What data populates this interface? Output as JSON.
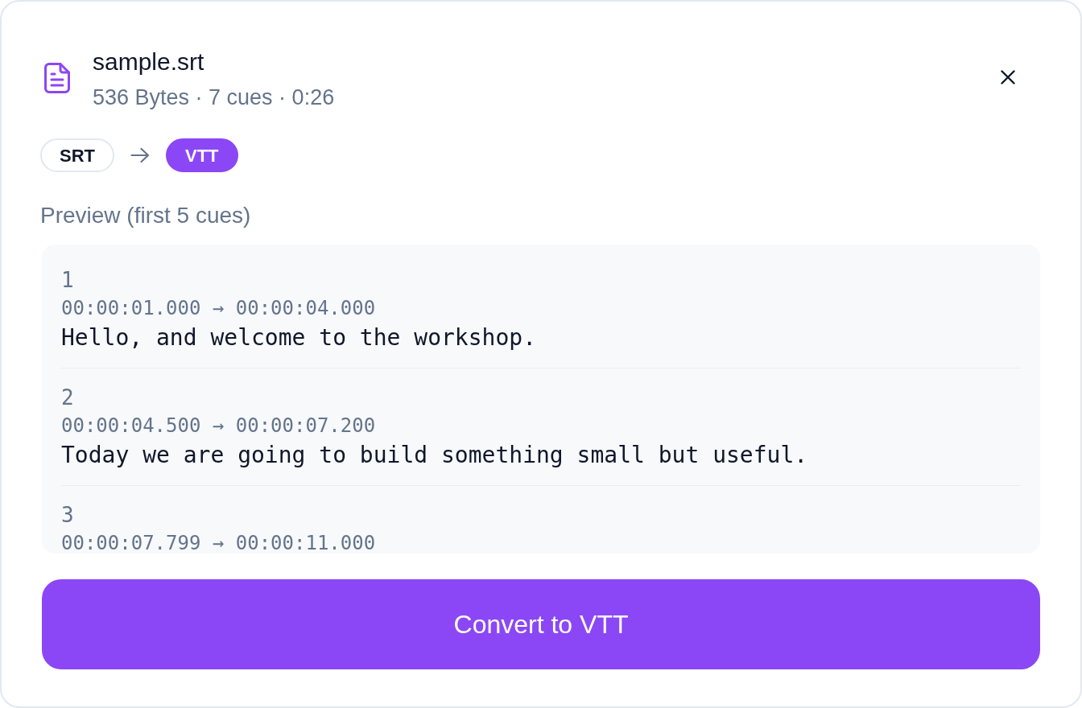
{
  "file": {
    "name": "sample.srt",
    "meta": "536 Bytes · 7 cues · 0:26"
  },
  "formats": [
    {
      "label": "SRT",
      "selected": false
    },
    {
      "label": "VTT",
      "selected": true
    }
  ],
  "preview": {
    "title": "Preview (first 5 cues)",
    "cues": [
      {
        "index": "1",
        "timing": "00:00:01.000 → 00:00:04.000",
        "text": "Hello, and welcome to the workshop."
      },
      {
        "index": "2",
        "timing": "00:00:04.500 → 00:00:07.200",
        "text": "Today we are going to build something small but useful."
      },
      {
        "index": "3",
        "timing": "00:00:07.799 → 00:00:11.000"
      }
    ]
  },
  "convert_button": {
    "label": "Convert to VTT"
  }
}
